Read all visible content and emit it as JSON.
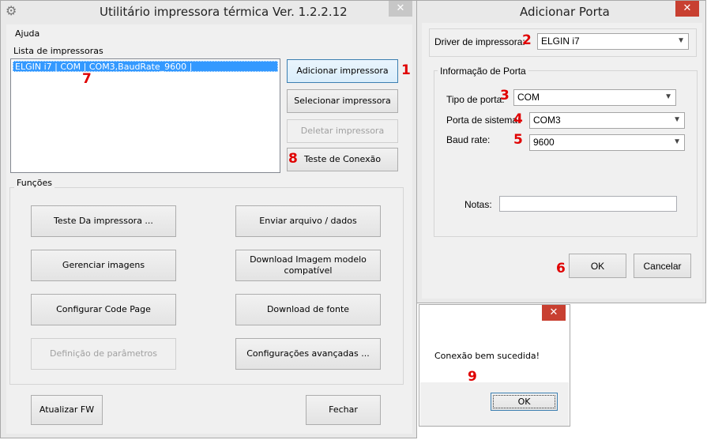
{
  "main_window": {
    "title": "Utilitário impressora térmica Ver. 1.2.2.12",
    "close_symbol": "✕",
    "menu": {
      "help": "Ajuda"
    },
    "printer_list": {
      "label": "Lista de impressoras",
      "items": [
        "ELGIN i7 | COM | COM3,BaudRate_9600 |"
      ]
    },
    "buttons": {
      "add_printer": "Adicionar impressora",
      "select_printer": "Selecionar impressora",
      "delete_printer": "Deletar impressora",
      "connection_test": "Teste de Conexão",
      "update_fw": "Atualizar FW",
      "close": "Fechar"
    },
    "functions": {
      "label": "Funções",
      "printer_test": "Teste Da impressora ...",
      "send_file": "Enviar arquivo / dados",
      "manage_images": "Gerenciar imagens",
      "download_image_line1": "Download Imagem modelo",
      "download_image_line2": "compatível",
      "config_code_page": "Configurar Code Page",
      "download_font": "Download de fonte",
      "param_definition": "Definição de parâmetros",
      "advanced_settings": "Configurações avançadas ..."
    }
  },
  "add_port_dialog": {
    "title": "Adicionar Porta",
    "close_symbol": "✕",
    "driver_label": "Driver de impressora:",
    "driver_value": "ELGIN i7",
    "port_info_label": "Informação de Porta",
    "port_type_label": "Tipo de porta:",
    "port_type_value": "COM",
    "system_port_label": "Porta de sistema:",
    "system_port_value": "COM3",
    "baud_rate_label": "Baud rate:",
    "baud_rate_value": "9600",
    "notes_label": "Notas:",
    "notes_value": "",
    "ok": "OK",
    "cancel": "Cancelar"
  },
  "message_box": {
    "close_symbol": "✕",
    "message": "Conexão bem sucedida!",
    "ok": "OK"
  },
  "step_markers": {
    "m1": "1",
    "m2": "2",
    "m3": "3",
    "m4": "4",
    "m5": "5",
    "m6": "6",
    "m7": "7",
    "m8": "8",
    "m9": "9"
  },
  "colors": {
    "close_button": "#c84031",
    "selection": "#3399ff",
    "marker": "#e00000",
    "window_frame": "#e9e9e9"
  },
  "icons": {
    "app_icon": "gear-icon",
    "dropdown": "chevron-down-icon",
    "close": "close-icon"
  }
}
